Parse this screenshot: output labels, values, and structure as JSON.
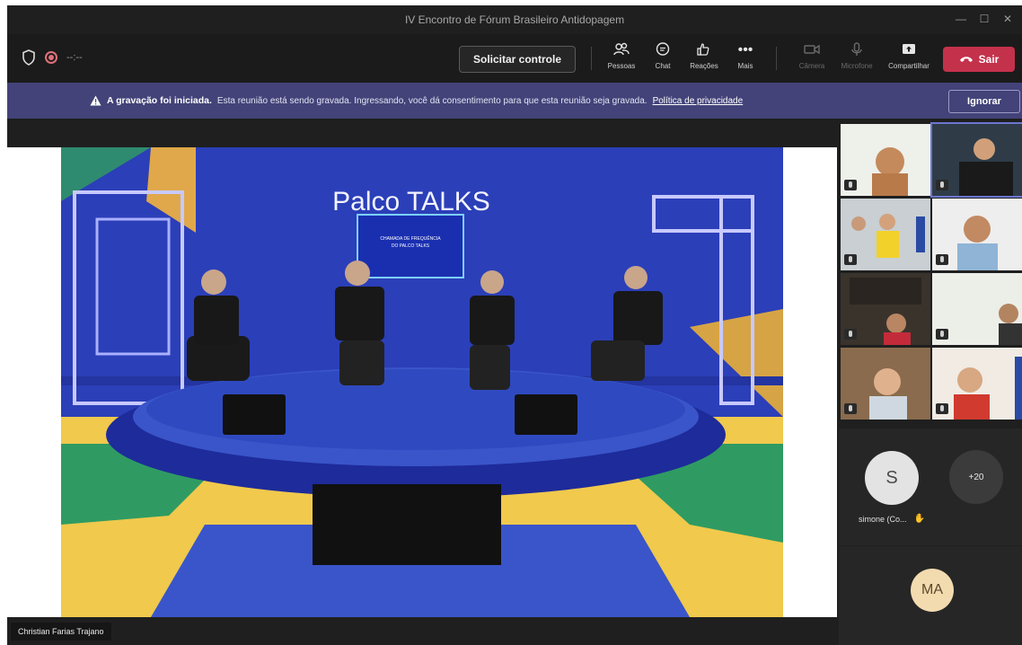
{
  "window": {
    "title": "IV Encontro de Fórum Brasileiro Antidopagem"
  },
  "toolbar": {
    "timer": "--:--",
    "request_control_label": "Solicitar controle",
    "tools": [
      {
        "name": "people",
        "label": "Pessoas",
        "icon": "people-icon"
      },
      {
        "name": "chat",
        "label": "Chat",
        "icon": "chat-icon"
      },
      {
        "name": "reactions",
        "label": "Reações",
        "icon": "reactions-icon"
      },
      {
        "name": "more",
        "label": "Mais",
        "icon": "more-icon"
      }
    ],
    "disabled_tools": [
      {
        "name": "camera",
        "label": "Câmera",
        "icon": "camera-icon"
      },
      {
        "name": "mic",
        "label": "Microfone",
        "icon": "mic-icon"
      }
    ],
    "share_label": "Compartilhar",
    "leave_label": "Sair"
  },
  "banner": {
    "title": "A gravação foi iniciada.",
    "message": "Esta reunião está sendo gravada. Ingressando, você dá consentimento para que esta reunião seja gravada.",
    "link": "Política de privacidade",
    "dismiss_label": "Ignorar"
  },
  "stage": {
    "presenter_name": "Christian Farias Trajano",
    "scene_logo": "Palco TALKS",
    "screen_text": [
      "CHAMADA DE FREQUÊNCIA",
      "DO PALCO TALKS"
    ]
  },
  "gallery": {
    "participant_initial": "S",
    "participant_name": "simone (Co...",
    "overflow_count": "+20",
    "self_initials": "MA"
  },
  "colors": {
    "leave": "#c4314b",
    "banner": "#434379",
    "stage_blue": "#2b3fb8"
  }
}
